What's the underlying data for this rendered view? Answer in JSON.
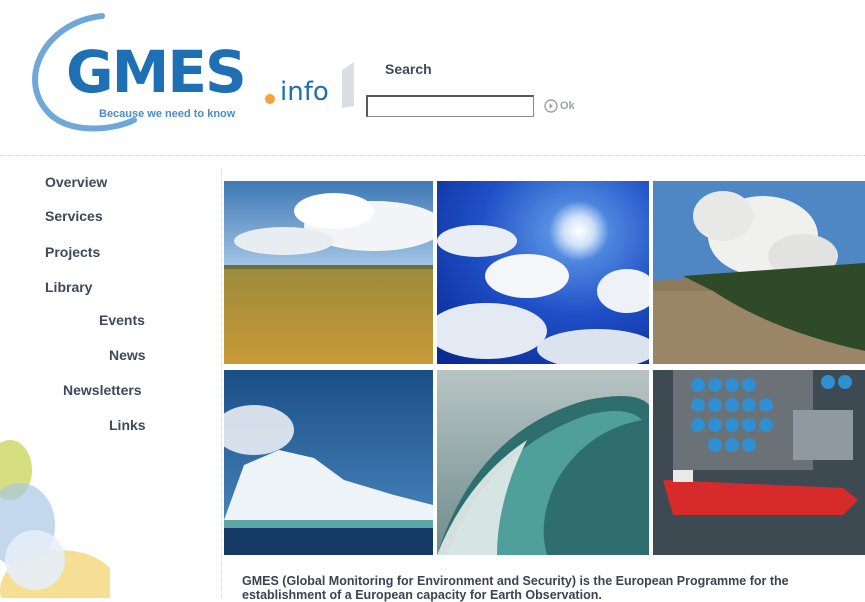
{
  "header": {
    "logo_main": "GMES",
    "logo_suffix": ".info",
    "tagline": "Because we need to know",
    "search_label": "Search",
    "search_value": "",
    "ok_label": "Ok"
  },
  "nav": {
    "items": [
      {
        "label": "Overview"
      },
      {
        "label": "Services"
      },
      {
        "label": "Projects"
      },
      {
        "label": "Library"
      },
      {
        "label": "Events"
      },
      {
        "label": "News"
      },
      {
        "label": "Newsletters"
      },
      {
        "label": "Links"
      }
    ]
  },
  "images": [
    {
      "name": "grassland-sky-image"
    },
    {
      "name": "sun-clouds-image"
    },
    {
      "name": "forest-fire-smoke-image"
    },
    {
      "name": "iceberg-image"
    },
    {
      "name": "ocean-wave-image"
    },
    {
      "name": "oil-tanker-port-image"
    }
  ],
  "description": "GMES (Global Monitoring for Environment and Security) is the European Programme for the establishment of a European capacity for Earth Observation.",
  "colors": {
    "brand_blue": "#1f6fb5",
    "accent_orange": "#f2a33a",
    "nav_text": "#3d4a5a"
  }
}
